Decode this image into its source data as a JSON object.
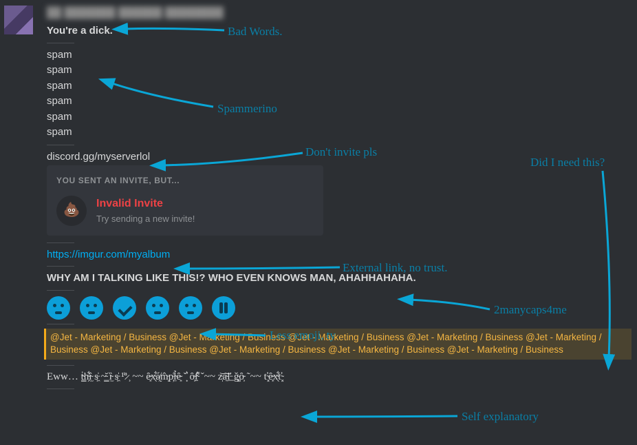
{
  "header_blur": "██ ███████ ██████   ████████",
  "lines": {
    "bad": "You're a dick.",
    "spam": "spam",
    "invite_link": "discord.gg/myserverlol",
    "url": "https://imgur.com/myalbum",
    "caps": "WHY AM I TALKING LIKE THIS!? WHO EVEN KNOWS MAN, AHAHHAHAHA.",
    "zalgo": "Eww… ṫ̴͇h̴̗͋ȉ̴̫ s̵͖̍ ~̴̳̆ ȉ̴̫ s̵͖̍  ¹͗ª̷ ͕ ~~ ȇ̴͙x̴̖͋á̸̰m̵̩̂p̵̦͑l̴̤̉ȇ̴͙ ˇ̟͛ ȏ̴͕f̴̠͌ ˇ~~ z̵̩͝a̴̼͝ľ̵̲ ǧ̵͚ȏ̴͕ ˜~~ ť̴͓ȇ̴͙x̴̖͋ť̴͓"
  },
  "invite": {
    "pre": "YOU SENT AN INVITE, BUT...",
    "title": "Invalid Invite",
    "sub": "Try sending a new invite!",
    "icon": "💩"
  },
  "mention_text": "@Jet - Marketing / Business @Jet - Marketing / Business @Jet - Marketing / Business @Jet - Marketing / Business @Jet - Marketing / Business @Jet - Marketing / Business @Jet - Marketing / Business @Jet - Marketing / Business @Jet - Marketing / Business",
  "annotations": {
    "bad": "Bad Words.",
    "spam": "Spammerino",
    "invite": "Don't invite pls",
    "extlink": "External link, no trust.",
    "caps": "2manycaps4me",
    "emoji": "Less emoji, ty",
    "mentions": "Did I need this?",
    "zalgo": "Self explanatory"
  }
}
